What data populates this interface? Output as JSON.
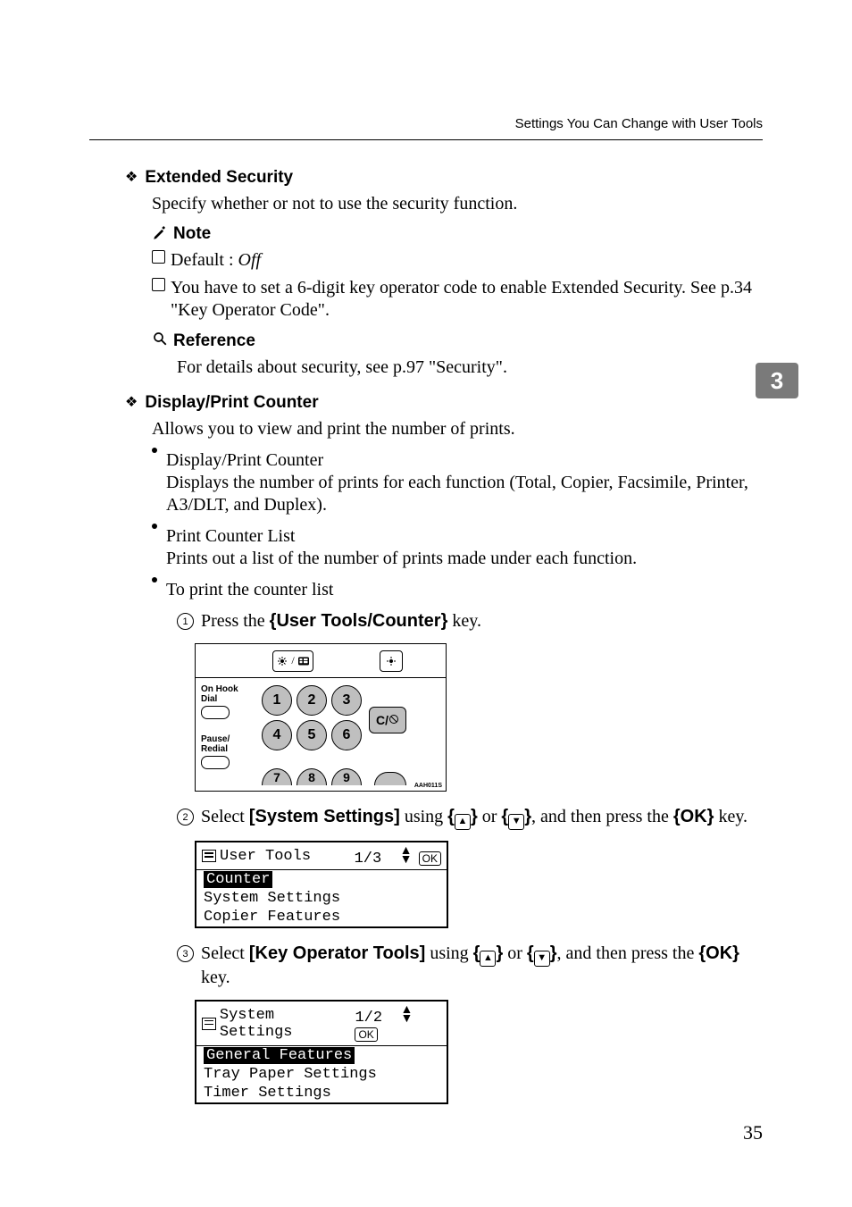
{
  "running_head": "Settings You Can Change with User Tools",
  "page_number": "35",
  "side_tab": "3",
  "sec1": {
    "heading": "Extended Security",
    "intro": "Specify whether or not to use the security function.",
    "note_label": "Note",
    "note_items": {
      "default_prefix": "Default : ",
      "default_value": "Off",
      "line2": "You have to set a 6-digit key operator code to enable Extended Security. See p.34 \"Key Operator Code\"."
    },
    "reference_label": "Reference",
    "reference_text": "For details about security, see p.97 \"Security\"."
  },
  "sec2": {
    "heading": "Display/Print Counter",
    "intro": "Allows you to view and print the number of prints.",
    "bullets": {
      "b1_title": "Display/Print Counter",
      "b1_body": "Displays the number of prints for each function (Total, Copier, Facsimile, Printer, A3/DLT, and Duplex).",
      "b2_title": "Print Counter List",
      "b2_body": "Prints out a list of the number of prints made under each function.",
      "b3_title": "To print the counter list"
    },
    "steps": {
      "s1_pre": "Press the ",
      "s1_key": "User Tools/Counter",
      "s1_post": " key.",
      "s2_pre": "Select ",
      "s2_item": "[System Settings]",
      "s2_mid": " using ",
      "s2_or": " or ",
      "s2_then": ", and then press the ",
      "s2_ok": "OK",
      "s2_post": " key.",
      "s3_pre": "Select ",
      "s3_item": "[Key Operator Tools]",
      "s3_mid": " using ",
      "s3_or": " or ",
      "s3_then": ", and then press the ",
      "s3_ok": "OK",
      "s3_post": " key."
    }
  },
  "keypad": {
    "left_label1": "On Hook Dial",
    "left_label2a": "Pause/",
    "left_label2b": "Redial",
    "keys": [
      "1",
      "2",
      "3",
      "4",
      "5",
      "6",
      "7",
      "8",
      "9"
    ],
    "clear": "C/",
    "caption": "AAH011S"
  },
  "lcd1": {
    "title": "User Tools",
    "pager": "1/3",
    "ok": "OK",
    "rows": [
      "Counter",
      "System Settings",
      "Copier Features"
    ],
    "highlight_index": 0
  },
  "lcd2": {
    "title": "System Settings",
    "pager": "1/2",
    "ok": "OK",
    "rows": [
      "General Features",
      "Tray Paper Settings",
      "Timer Settings"
    ],
    "highlight_index": 0
  }
}
